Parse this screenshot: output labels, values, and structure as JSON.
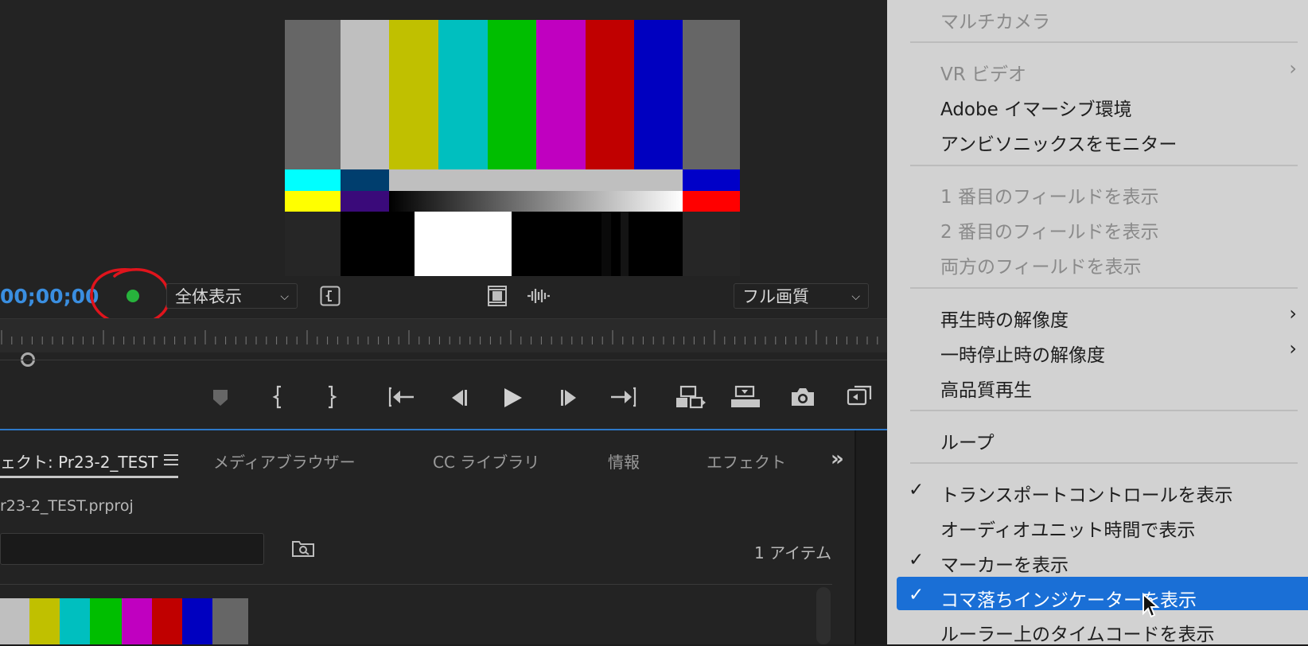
{
  "monitor": {
    "timecode": "00;00;00",
    "zoom_select": "全体表示",
    "quality_select": "フル画質"
  },
  "panel": {
    "tabs": [
      "ェクト: Pr23-2_TEST",
      "メディアブラウザー",
      "CC ライブラリ",
      "情報",
      "エフェクト"
    ],
    "overflow": "»",
    "project_file": "r23-2_TEST.prproj",
    "item_count": "1 アイテム"
  },
  "menu": {
    "items": [
      {
        "label": "マルチカメラ"
      },
      {
        "label": "VR ビデオ"
      },
      {
        "label": "Adobe イマーシブ環境"
      },
      {
        "label": "アンビソニックスをモニター"
      },
      {
        "label": "1 番目のフィールドを表示"
      },
      {
        "label": "2 番目のフィールドを表示"
      },
      {
        "label": "両方のフィールドを表示"
      },
      {
        "label": "再生時の解像度"
      },
      {
        "label": "一時停止時の解像度"
      },
      {
        "label": "高品質再生"
      },
      {
        "label": "ループ"
      },
      {
        "label": "トランスポートコントロールを表示"
      },
      {
        "label": "オーディオユニット時間で表示"
      },
      {
        "label": "マーカーを表示"
      },
      {
        "label": "コマ落ちインジケーターを表示"
      },
      {
        "label": "ルーラー上のタイムコードを表示"
      }
    ]
  },
  "colors": {
    "accent": "#1a6fd6",
    "timecode": "#3a8ee0",
    "indicator": "#27b33c",
    "annotation": "#e0141c"
  }
}
